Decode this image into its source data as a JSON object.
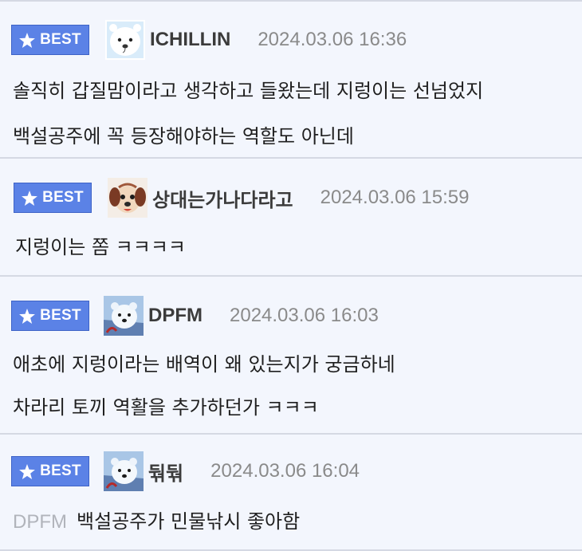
{
  "comments": [
    {
      "badge": "BEST",
      "nickname": "ICHILLIN",
      "avatar": "white-bear-face-icon",
      "date": "2024.03.06 16:36",
      "lines": [
        "솔직히 갑질맘이라고 생각하고 들왔는데 지렁이는 선넘었지",
        "백설공주에 꼭 등장해야하는 역할도 아닌데"
      ]
    },
    {
      "badge": "BEST",
      "nickname": "상대는가나다라고",
      "avatar": "puppy-face-icon",
      "date": "2024.03.06 15:59",
      "lines": [
        "지렁이는 쫌 ㅋㅋㅋㅋ"
      ]
    },
    {
      "badge": "BEST",
      "nickname": "DPFM",
      "avatar": "polar-bear-icon",
      "date": "2024.03.06 16:03",
      "lines": [
        "애초에 지렁이라는 배역이 왜 있는지가 궁금하네",
        "차라리 토끼 역활을 추가하던가 ㅋㅋㅋ"
      ]
    },
    {
      "badge": "BEST",
      "nickname": "둮둮",
      "avatar": "polar-bear-icon",
      "date": "2024.03.06 16:04",
      "reply_to": "DPFM",
      "lines": [
        "백설공주가 민물낚시 좋아함"
      ]
    }
  ],
  "colors": {
    "background": "#f3f6fd",
    "badge": "#5b82e6",
    "divider": "#d5d9e3",
    "date": "#8a8a8a",
    "reply_to": "#b1b4bb"
  }
}
